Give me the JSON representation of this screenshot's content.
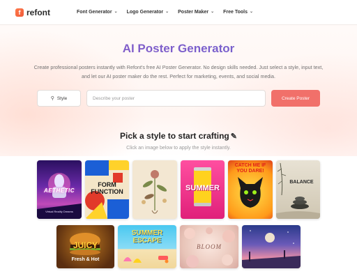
{
  "header": {
    "logo_letter": "f",
    "logo_text": "refont",
    "nav": [
      {
        "label": "Font Generator"
      },
      {
        "label": "Logo Generator"
      },
      {
        "label": "Poster Maker"
      },
      {
        "label": "Free Tools"
      }
    ]
  },
  "hero": {
    "title": "AI Poster Generator",
    "description": "Create professional posters instantly with Refont's free AI Poster Generator. No design skills needed. Just select a style, input text, and let our AI poster maker do the rest. Perfect for marketing, events, and social media."
  },
  "search": {
    "style_label": "Style",
    "placeholder": "Describe your poster",
    "value": "",
    "create_label": "Create Poster"
  },
  "styles_section": {
    "title": "Pick a style to start crafting",
    "subtitle": "Click an image below to apply the style instantly."
  },
  "styles": [
    {
      "title": "AETHETIC",
      "caption": "Virtual Reality Dreams"
    },
    {
      "title": "FORM FUNCTION",
      "caption": ""
    },
    {
      "title": "",
      "caption": ""
    },
    {
      "title": "SUMMER",
      "caption": ""
    },
    {
      "title": "CATCH ME IF YOU DARE!",
      "caption": ""
    },
    {
      "title": "BALANCE",
      "caption": ""
    },
    {
      "title": "JUICY",
      "caption": "Fresh & Hot"
    },
    {
      "title": "SUMMER ESCAPE",
      "caption": ""
    },
    {
      "title": "BLOOM",
      "caption": ""
    },
    {
      "title": "",
      "caption": ""
    }
  ],
  "colors": {
    "accent": "#f1706a",
    "title_gradient_start": "#8a5ac6",
    "title_gradient_end": "#6f63d0"
  }
}
